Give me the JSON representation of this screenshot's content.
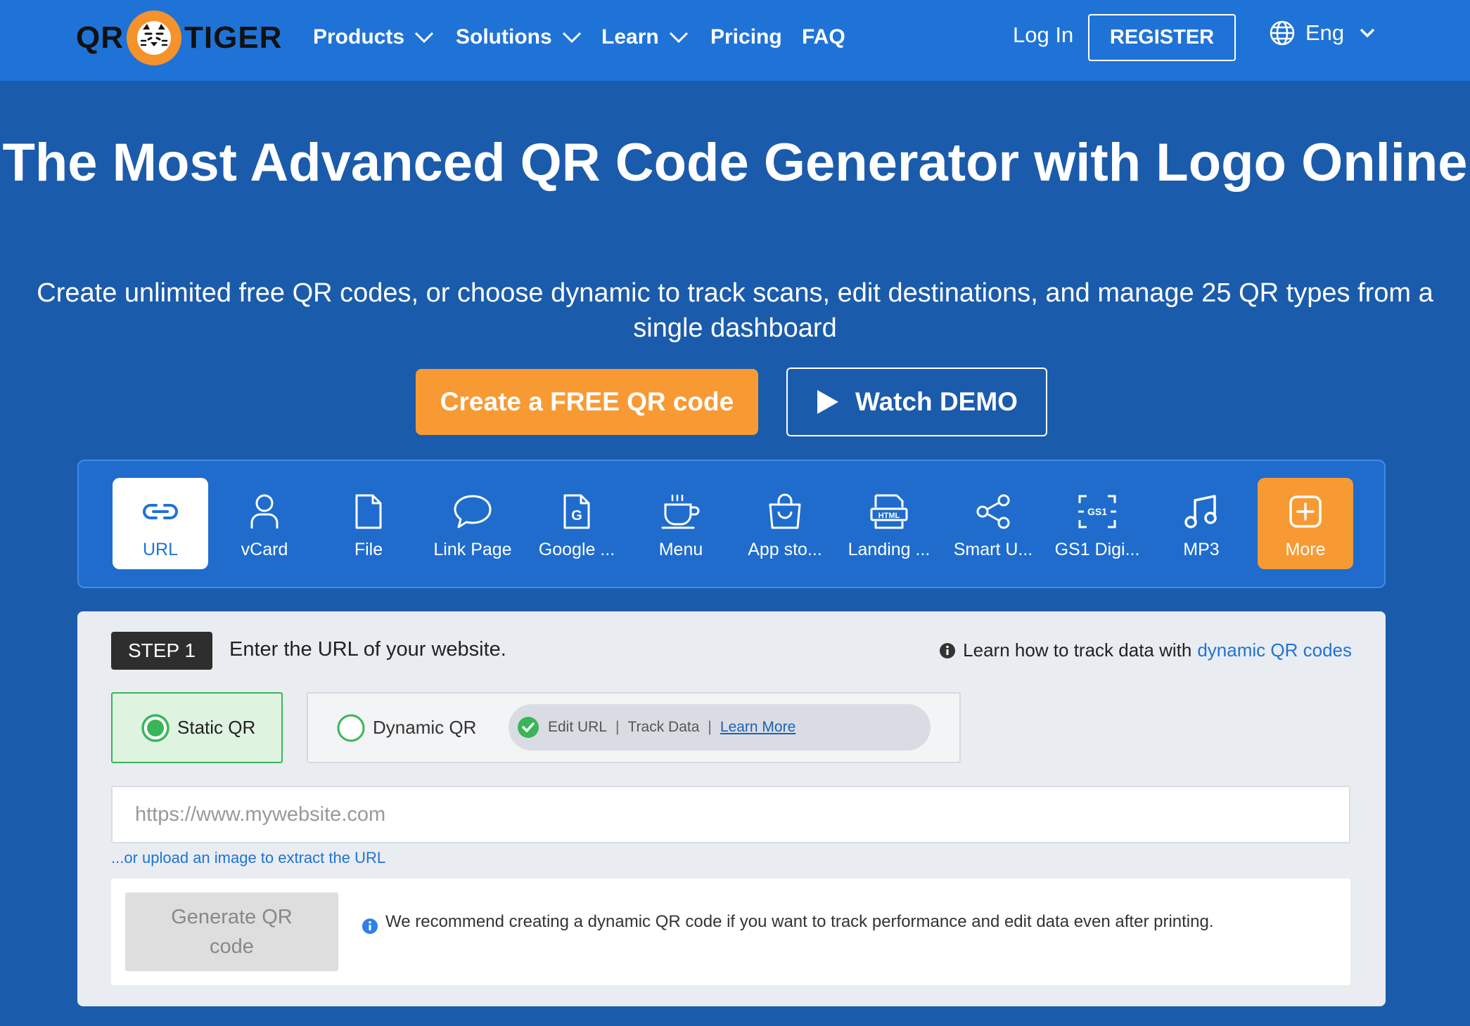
{
  "header": {
    "logo": {
      "left": "QR",
      "right": "TIGER"
    },
    "nav": [
      {
        "label": "Products",
        "dropdown": true
      },
      {
        "label": "Solutions",
        "dropdown": true
      },
      {
        "label": "Learn",
        "dropdown": true
      },
      {
        "label": "Pricing",
        "dropdown": false
      },
      {
        "label": "FAQ",
        "dropdown": false
      }
    ],
    "login": "Log In",
    "register": "REGISTER",
    "language": "Eng"
  },
  "hero": {
    "title": "The Most Advanced QR Code Generator with Logo Online",
    "subtitle": "Create unlimited free QR codes, or choose dynamic to track scans, edit destinations, and manage 25 QR types from a single dashboard",
    "cta_primary": "Create a FREE QR code",
    "cta_secondary": "Watch DEMO"
  },
  "qr_types": {
    "selected": "URL",
    "items": [
      {
        "label": "URL",
        "icon": "link-icon"
      },
      {
        "label": "vCard",
        "icon": "person-icon"
      },
      {
        "label": "File",
        "icon": "file-icon"
      },
      {
        "label": "Link Page",
        "icon": "chat-bubble-icon"
      },
      {
        "label": "Google ...",
        "icon": "google-doc-icon"
      },
      {
        "label": "Menu",
        "icon": "coffee-cup-icon"
      },
      {
        "label": "App sto...",
        "icon": "shopping-bag-icon"
      },
      {
        "label": "Landing ...",
        "icon": "html-icon"
      },
      {
        "label": "Smart U...",
        "icon": "share-icon"
      },
      {
        "label": "GS1 Digi...",
        "icon": "gs1-icon"
      },
      {
        "label": "MP3",
        "icon": "music-note-icon"
      },
      {
        "label": "More",
        "icon": "plus-square-icon"
      }
    ]
  },
  "form": {
    "step_badge": "STEP 1",
    "step_text": "Enter the URL of your website.",
    "track_hint_text": "Learn how to track data with",
    "track_hint_link": "dynamic QR codes",
    "option_static": "Static QR",
    "option_dynamic": "Dynamic QR",
    "selected_option": "Static QR",
    "dynamic_features": [
      "Edit URL",
      "Track Data"
    ],
    "dynamic_learn_more": "Learn More",
    "url_placeholder": "https://www.mywebsite.com",
    "url_value": "",
    "upload_link": "...or upload an image to extract the URL",
    "generate_button": "Generate QR code",
    "recommendation": "We recommend creating a dynamic QR code if you want to track performance and edit data even after printing."
  },
  "colors": {
    "header_bg": "#1f73d6",
    "page_bg": "#1b5bab",
    "accent_orange": "#f89a34",
    "accent_green": "#3bb55a",
    "link_blue": "#1f73d6"
  }
}
